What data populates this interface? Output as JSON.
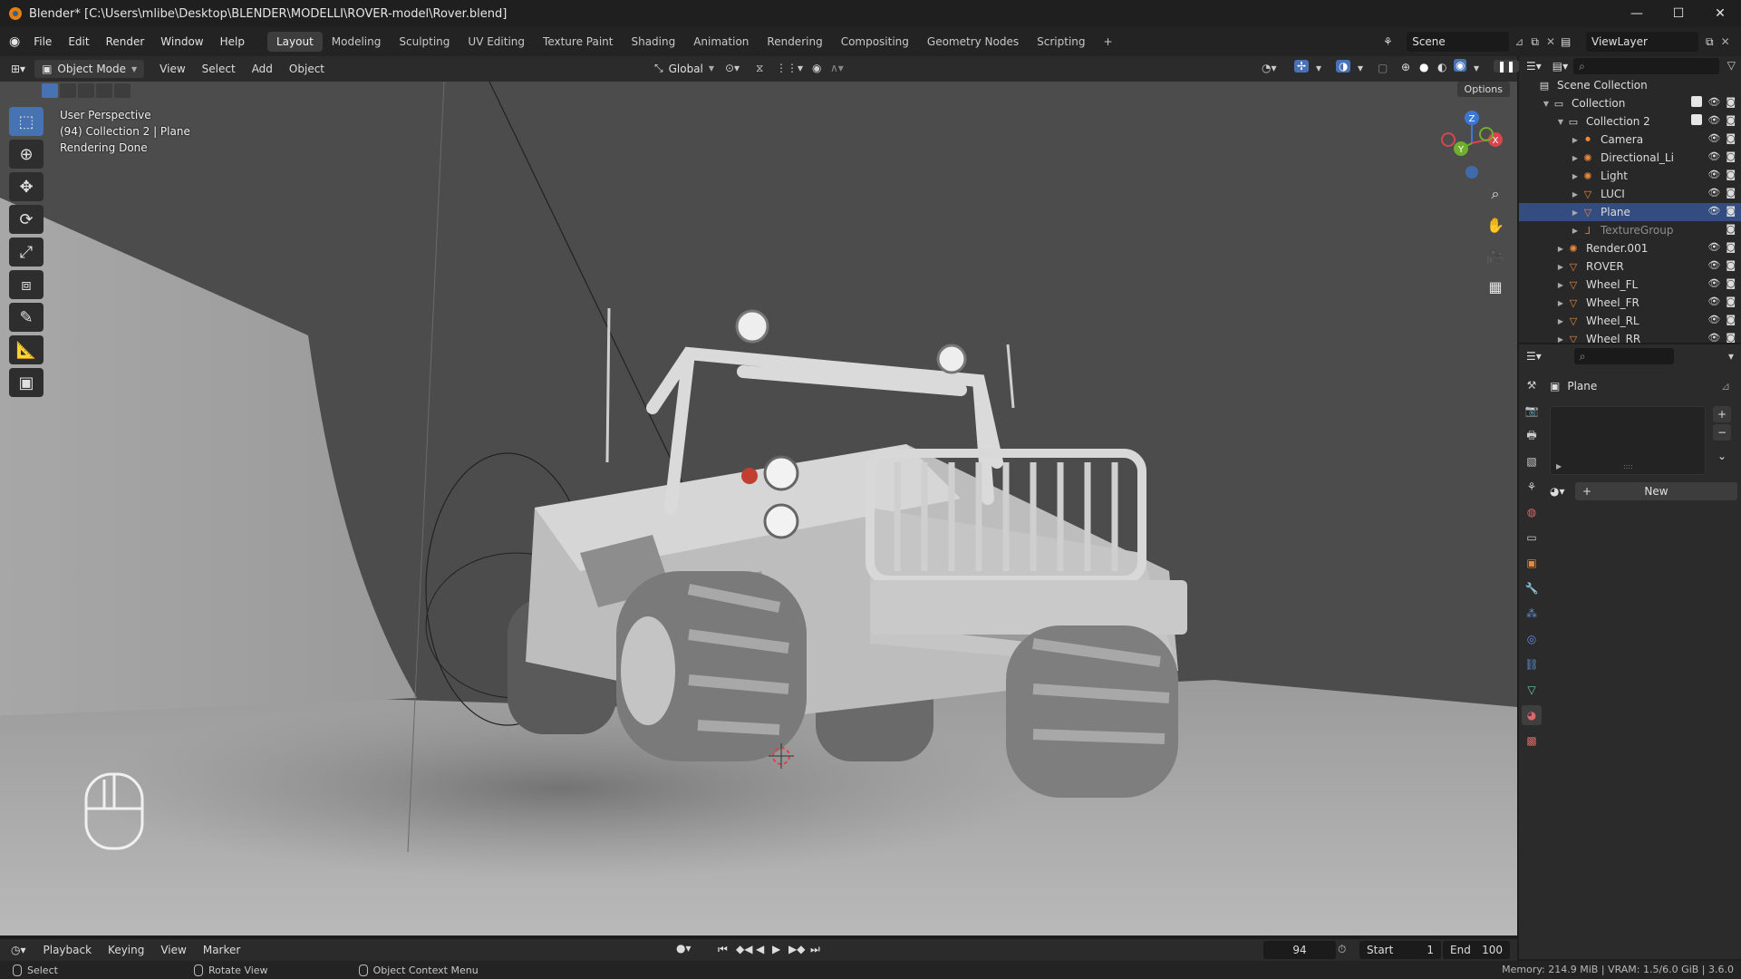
{
  "window": {
    "title": "Blender* [C:\\Users\\mlibe\\Desktop\\BLENDER\\MODELLI\\ROVER-model\\Rover.blend]",
    "controls": [
      "—",
      "☐",
      "✕"
    ]
  },
  "menubar": {
    "menus": [
      "File",
      "Edit",
      "Render",
      "Window",
      "Help"
    ],
    "workspaces": [
      "Layout",
      "Modeling",
      "Sculpting",
      "UV Editing",
      "Texture Paint",
      "Shading",
      "Animation",
      "Rendering",
      "Compositing",
      "Geometry Nodes",
      "Scripting"
    ],
    "add_workspace": "+",
    "scene": "Scene",
    "view_layer": "ViewLayer"
  },
  "viewport_header": {
    "mode": "Object Mode",
    "menus": [
      "View",
      "Select",
      "Add",
      "Object"
    ],
    "transform_orientation": "Global",
    "options": "Options"
  },
  "viewport": {
    "info_lines": [
      "User Perspective",
      "(94) Collection 2 | Plane",
      "Rendering Done"
    ],
    "gizmo_axes": [
      "Z",
      "Y",
      "X"
    ]
  },
  "outliner": {
    "rows": [
      {
        "label": "Scene Collection",
        "depth": 0,
        "icon": "scene-collection-icon"
      },
      {
        "label": "Collection",
        "depth": 1,
        "icon": "collection-icon"
      },
      {
        "label": "Collection 2",
        "depth": 2,
        "icon": "collection-icon"
      },
      {
        "label": "Camera",
        "depth": 3,
        "icon": "camera-object-icon"
      },
      {
        "label": "Directional_Li",
        "depth": 3,
        "icon": "light-object-icon"
      },
      {
        "label": "Light",
        "depth": 3,
        "icon": "light-object-icon"
      },
      {
        "label": "LUCI",
        "depth": 3,
        "icon": "mesh-object-icon"
      },
      {
        "label": "Plane",
        "depth": 3,
        "icon": "mesh-object-icon",
        "selected": true
      },
      {
        "label": "TextureGroup",
        "depth": 3,
        "icon": "empty-object-icon",
        "dim": true
      },
      {
        "label": "Render.001",
        "depth": 2,
        "icon": "light-object-icon"
      },
      {
        "label": "ROVER",
        "depth": 2,
        "icon": "mesh-object-icon"
      },
      {
        "label": "Wheel_FL",
        "depth": 2,
        "icon": "mesh-object-icon"
      },
      {
        "label": "Wheel_FR",
        "depth": 2,
        "icon": "mesh-object-icon"
      },
      {
        "label": "Wheel_RL",
        "depth": 2,
        "icon": "mesh-object-icon"
      },
      {
        "label": "Wheel_RR",
        "depth": 2,
        "icon": "mesh-object-icon"
      }
    ]
  },
  "properties": {
    "object_name": "Plane",
    "new_button": "New"
  },
  "timeline": {
    "menus": [
      "Playback",
      "Keying",
      "View",
      "Marker"
    ],
    "current_frame": "94",
    "start_label": "Start",
    "start_value": "1",
    "end_label": "End",
    "end_value": "100"
  },
  "statusbar": {
    "select": "Select",
    "rotate": "Rotate View",
    "context": "Object Context Menu",
    "memory": "Memory: 214.9 MiB | VRAM: 1.5/6.0 GiB | 3.6.0"
  },
  "colors": {
    "accent": "#4772b3",
    "selected_row": "#334d80",
    "blender_orange": "#e87d0d"
  }
}
